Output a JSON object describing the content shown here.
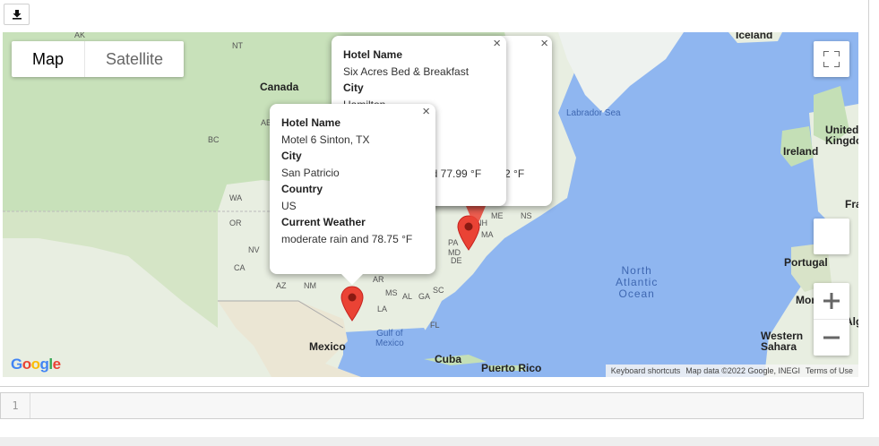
{
  "toolbar": {
    "download_icon": "download-icon"
  },
  "map": {
    "type_buttons": {
      "map": "Map",
      "satellite": "Satellite"
    },
    "labels": {
      "ak": "AK",
      "nt": "NT",
      "canada": "Canada",
      "ab": "AB",
      "bc": "BC",
      "wa": "WA",
      "or": "OR",
      "nv": "NV",
      "ca": "CA",
      "az": "AZ",
      "nm": "NM",
      "ar": "AR",
      "ms": "MS",
      "al": "AL",
      "ga": "GA",
      "sc": "SC",
      "la": "LA",
      "fl": "FL",
      "pa": "PA",
      "md": "MD",
      "de": "DE",
      "me": "ME",
      "ns": "NS",
      "nh": "NH",
      "ma": "MA",
      "mexico": "Mexico",
      "gulf": "Gulf of\nMexico",
      "cuba": "Cuba",
      "puerto_rico": "Puerto Rico",
      "labrador": "Labrador Sea",
      "north_atlantic": "North\nAtlantic\nOcean",
      "iceland": "Iceland",
      "ireland": "Ireland",
      "uk": "United\nKingdo",
      "fra": "Fra",
      "portugal": "Portugal",
      "mor": "Mor",
      "alg": "Alg",
      "western_sahara": "Western\nSahara"
    },
    "google": "Google",
    "footer": {
      "shortcuts": "Keyboard shortcuts",
      "data": "Map data ©2022 Google, INEGI",
      "terms": "Terms of Use"
    },
    "infowindows": [
      {
        "h1": "Hotel Name",
        "v1": "Six Acres Bed & Breakfast",
        "h2": "City",
        "v2": "Hamilton",
        "tail_frag": "nd 77.99 °F"
      },
      {
        "tail_frag": ".02 °F"
      },
      {
        "h1": "Hotel Name",
        "v1": "Motel 6 Sinton, TX",
        "h2": "City",
        "v2": "San Patricio",
        "h3": "Country",
        "v3": "US",
        "h4": "Current Weather",
        "v4": "moderate rain and 78.75 °F"
      }
    ],
    "close_glyph": "×"
  },
  "cell": {
    "number": "1"
  },
  "colors": {
    "water": "#8fb6f0",
    "land": "#e8eee1",
    "green": "#c4dfb6",
    "marker": "#ea4335"
  }
}
